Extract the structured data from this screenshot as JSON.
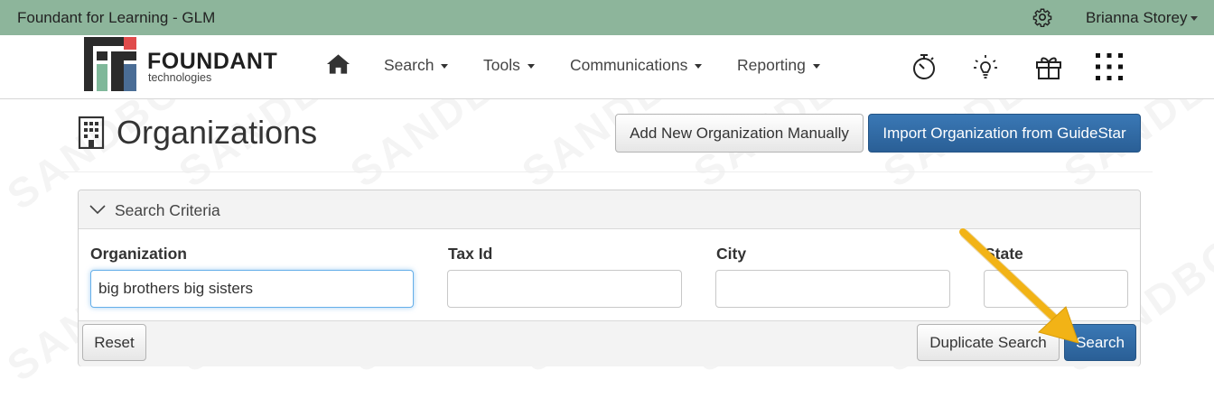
{
  "topbar": {
    "site_title": "Foundant for Learning - GLM",
    "user_name": "Brianna Storey",
    "bg_color": "#8db59b"
  },
  "logo": {
    "brand": "FOUNDANT",
    "sub": "technologies"
  },
  "nav": {
    "items": [
      {
        "label": "Search"
      },
      {
        "label": "Tools"
      },
      {
        "label": "Communications"
      },
      {
        "label": "Reporting"
      }
    ],
    "icons": [
      "stopwatch-icon",
      "lightbulb-icon",
      "gift-icon",
      "apps-grid-icon"
    ]
  },
  "page": {
    "title": "Organizations",
    "add_button": "Add New Organization Manually",
    "import_button": "Import Organization from GuideStar"
  },
  "search_panel": {
    "heading": "Search Criteria",
    "fields": [
      {
        "label": "Organization",
        "value": "big brothers big sisters"
      },
      {
        "label": "Tax Id",
        "value": ""
      },
      {
        "label": "City",
        "value": ""
      },
      {
        "label": "State",
        "value": ""
      }
    ],
    "reset_button": "Reset",
    "duplicate_button": "Duplicate Search",
    "search_button": "Search"
  },
  "watermark": "SANDBOX",
  "colors": {
    "primary": "#2a5f96",
    "arrow": "#f2b316",
    "logo_red": "#e04b4b",
    "logo_green": "#7fb89a",
    "logo_blue": "#4a6d96",
    "logo_dark": "#2b2b2b"
  }
}
